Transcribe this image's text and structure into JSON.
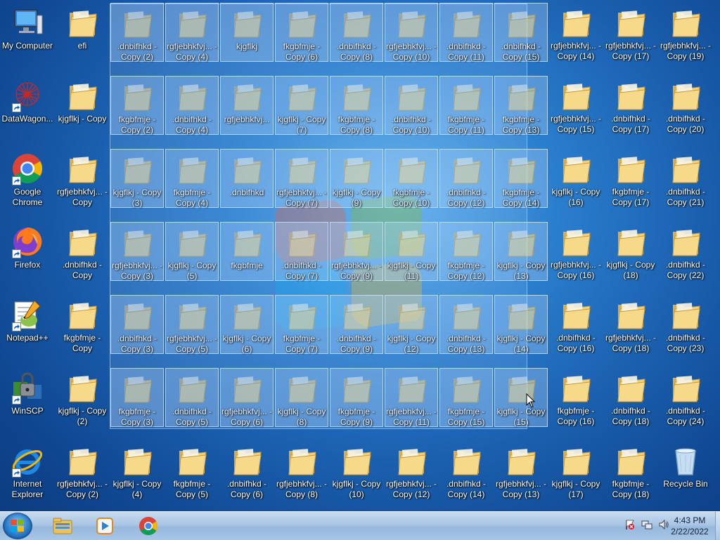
{
  "desktop": {
    "icons": [
      {
        "label": "My Computer",
        "type": "computer",
        "shortcut": false,
        "selected": false
      },
      {
        "label": "efi",
        "type": "folder",
        "shortcut": false,
        "selected": false
      },
      {
        "label": ".dnbifhkd - Copy (2)",
        "type": "folder",
        "shortcut": false,
        "selected": true
      },
      {
        "label": "rgfjebhkfvj... - Copy (4)",
        "type": "folder",
        "shortcut": false,
        "selected": true
      },
      {
        "label": "kjgflkj",
        "type": "folder",
        "shortcut": false,
        "selected": true
      },
      {
        "label": "fkgbfmje - Copy (6)",
        "type": "folder",
        "shortcut": false,
        "selected": true
      },
      {
        "label": ".dnbifhkd - Copy (8)",
        "type": "folder",
        "shortcut": false,
        "selected": true
      },
      {
        "label": "rgfjebhkfvj... - Copy (10)",
        "type": "folder",
        "shortcut": false,
        "selected": true
      },
      {
        "label": ".dnbifhkd - Copy (11)",
        "type": "folder",
        "shortcut": false,
        "selected": true
      },
      {
        "label": ".dnbifhkd - Copy (15)",
        "type": "folder",
        "shortcut": false,
        "selected": true
      },
      {
        "label": "rgfjebhkfvj... - Copy (14)",
        "type": "folder",
        "shortcut": false,
        "selected": false
      },
      {
        "label": "rgfjebhkfvj... - Copy (17)",
        "type": "folder",
        "shortcut": false,
        "selected": false
      },
      {
        "label": "rgfjebhkfvj... - Copy (19)",
        "type": "folder",
        "shortcut": false,
        "selected": false
      },
      {
        "label": "DataWagon...",
        "type": "datawagon",
        "shortcut": true,
        "selected": false
      },
      {
        "label": "kjgflkj - Copy",
        "type": "folder",
        "shortcut": false,
        "selected": false
      },
      {
        "label": "fkgbfmje - Copy (2)",
        "type": "folder",
        "shortcut": false,
        "selected": true
      },
      {
        "label": ".dnbifhkd - Copy (4)",
        "type": "folder",
        "shortcut": false,
        "selected": true
      },
      {
        "label": "rgfjebhkfvj...",
        "type": "folder",
        "shortcut": false,
        "selected": true
      },
      {
        "label": "kjgflkj - Copy (7)",
        "type": "folder",
        "shortcut": false,
        "selected": true
      },
      {
        "label": "fkgbfmje - Copy (8)",
        "type": "folder",
        "shortcut": false,
        "selected": true
      },
      {
        "label": ".dnbifhkd - Copy (10)",
        "type": "folder",
        "shortcut": false,
        "selected": true
      },
      {
        "label": "fkgbfmje - Copy (11)",
        "type": "folder",
        "shortcut": false,
        "selected": true
      },
      {
        "label": "fkgbfmje - Copy (13)",
        "type": "folder",
        "shortcut": false,
        "selected": true
      },
      {
        "label": "rgfjebhkfvj... - Copy (15)",
        "type": "folder",
        "shortcut": false,
        "selected": false
      },
      {
        "label": ".dnbifhkd - Copy (17)",
        "type": "folder",
        "shortcut": false,
        "selected": false
      },
      {
        "label": ".dnbifhkd - Copy (20)",
        "type": "folder",
        "shortcut": false,
        "selected": false
      },
      {
        "label": "Google Chrome",
        "type": "chrome",
        "shortcut": true,
        "selected": false
      },
      {
        "label": "rgfjebhkfvj... - Copy",
        "type": "folder",
        "shortcut": false,
        "selected": false
      },
      {
        "label": "kjgflkj - Copy (3)",
        "type": "folder",
        "shortcut": false,
        "selected": true
      },
      {
        "label": "fkgbfmje - Copy (4)",
        "type": "folder",
        "shortcut": false,
        "selected": true
      },
      {
        "label": ".dnbifhkd",
        "type": "folder",
        "shortcut": false,
        "selected": true
      },
      {
        "label": "rgfjebhkfvj... - Copy (7)",
        "type": "folder",
        "shortcut": false,
        "selected": true
      },
      {
        "label": "kjgflkj - Copy (9)",
        "type": "folder",
        "shortcut": false,
        "selected": true
      },
      {
        "label": "fkgbfmje - Copy (10)",
        "type": "folder",
        "shortcut": false,
        "selected": true
      },
      {
        "label": ".dnbifhkd - Copy (12)",
        "type": "folder",
        "shortcut": false,
        "selected": true
      },
      {
        "label": "fkgbfmje - Copy (14)",
        "type": "folder",
        "shortcut": false,
        "selected": true
      },
      {
        "label": "kjgflkj - Copy (16)",
        "type": "folder",
        "shortcut": false,
        "selected": false
      },
      {
        "label": "fkgbfmje - Copy (17)",
        "type": "folder",
        "shortcut": false,
        "selected": false
      },
      {
        "label": ".dnbifhkd - Copy (21)",
        "type": "folder",
        "shortcut": false,
        "selected": false
      },
      {
        "label": "Firefox",
        "type": "firefox",
        "shortcut": true,
        "selected": false
      },
      {
        "label": ".dnbifhkd - Copy",
        "type": "folder",
        "shortcut": false,
        "selected": false
      },
      {
        "label": "rgfjebhkfvj... - Copy (3)",
        "type": "folder",
        "shortcut": false,
        "selected": true
      },
      {
        "label": "kjgflkj - Copy (5)",
        "type": "folder",
        "shortcut": false,
        "selected": true
      },
      {
        "label": "fkgbfmje",
        "type": "folder",
        "shortcut": false,
        "selected": true
      },
      {
        "label": ".dnbifhkd - Copy (7)",
        "type": "folder",
        "shortcut": false,
        "selected": true
      },
      {
        "label": "rgfjebhkfvj... - Copy (9)",
        "type": "folder",
        "shortcut": false,
        "selected": true
      },
      {
        "label": "kjgflkj - Copy (11)",
        "type": "folder",
        "shortcut": false,
        "selected": true
      },
      {
        "label": "fkgbfmje - Copy (12)",
        "type": "folder",
        "shortcut": false,
        "selected": true
      },
      {
        "label": "kjgflkj - Copy (13)",
        "type": "folder",
        "shortcut": false,
        "selected": true
      },
      {
        "label": "rgfjebhkfvj... - Copy (16)",
        "type": "folder",
        "shortcut": false,
        "selected": false
      },
      {
        "label": "kjgflkj - Copy (18)",
        "type": "folder",
        "shortcut": false,
        "selected": false
      },
      {
        "label": ".dnbifhkd - Copy (22)",
        "type": "folder",
        "shortcut": false,
        "selected": false
      },
      {
        "label": "Notepad++",
        "type": "notepad",
        "shortcut": true,
        "selected": false
      },
      {
        "label": "fkgbfmje - Copy",
        "type": "folder",
        "shortcut": false,
        "selected": false
      },
      {
        "label": ".dnbifhkd - Copy (3)",
        "type": "folder",
        "shortcut": false,
        "selected": true
      },
      {
        "label": "rgfjebhkfvj... - Copy (5)",
        "type": "folder",
        "shortcut": false,
        "selected": true
      },
      {
        "label": "kjgflkj - Copy (6)",
        "type": "folder",
        "shortcut": false,
        "selected": true
      },
      {
        "label": "fkgbfmje - Copy (7)",
        "type": "folder",
        "shortcut": false,
        "selected": true
      },
      {
        "label": ".dnbifhkd - Copy (9)",
        "type": "folder",
        "shortcut": false,
        "selected": true
      },
      {
        "label": "kjgflkj - Copy (12)",
        "type": "folder",
        "shortcut": false,
        "selected": true
      },
      {
        "label": ".dnbifhkd - Copy (13)",
        "type": "folder",
        "shortcut": false,
        "selected": true
      },
      {
        "label": "kjgflkj - Copy (14)",
        "type": "folder",
        "shortcut": false,
        "selected": true
      },
      {
        "label": ".dnbifhkd - Copy (16)",
        "type": "folder",
        "shortcut": false,
        "selected": false
      },
      {
        "label": "rgfjebhkfvj... - Copy (18)",
        "type": "folder",
        "shortcut": false,
        "selected": false
      },
      {
        "label": ".dnbifhkd - Copy (23)",
        "type": "folder",
        "shortcut": false,
        "selected": false
      },
      {
        "label": "WinSCP",
        "type": "winscp",
        "shortcut": true,
        "selected": false
      },
      {
        "label": "kjgflkj - Copy (2)",
        "type": "folder",
        "shortcut": false,
        "selected": false
      },
      {
        "label": "fkgbfmje - Copy (3)",
        "type": "folder",
        "shortcut": false,
        "selected": true
      },
      {
        "label": ".dnbifhkd - Copy (5)",
        "type": "folder",
        "shortcut": false,
        "selected": true
      },
      {
        "label": "rgfjebhkfvj... - Copy (6)",
        "type": "folder",
        "shortcut": false,
        "selected": true
      },
      {
        "label": "kjgflkj - Copy (8)",
        "type": "folder",
        "shortcut": false,
        "selected": true
      },
      {
        "label": "fkgbfmje - Copy (9)",
        "type": "folder",
        "shortcut": false,
        "selected": true
      },
      {
        "label": "rgfjebhkfvj... - Copy (11)",
        "type": "folder",
        "shortcut": false,
        "selected": true
      },
      {
        "label": "fkgbfmje - Copy (15)",
        "type": "folder",
        "shortcut": false,
        "selected": true
      },
      {
        "label": "kjgflkj - Copy (15)",
        "type": "folder",
        "shortcut": false,
        "selected": true
      },
      {
        "label": "fkgbfmje - Copy (16)",
        "type": "folder",
        "shortcut": false,
        "selected": false
      },
      {
        "label": ".dnbifhkd - Copy (18)",
        "type": "folder",
        "shortcut": false,
        "selected": false
      },
      {
        "label": ".dnbifhkd - Copy (24)",
        "type": "folder",
        "shortcut": false,
        "selected": false
      },
      {
        "label": "Internet Explorer",
        "type": "ie",
        "shortcut": true,
        "selected": false
      },
      {
        "label": "rgfjebhkfvj... - Copy (2)",
        "type": "folder",
        "shortcut": false,
        "selected": false
      },
      {
        "label": "kjgflkj - Copy (4)",
        "type": "folder",
        "shortcut": false,
        "selected": false
      },
      {
        "label": "fkgbfmje - Copy (5)",
        "type": "folder",
        "shortcut": false,
        "selected": false
      },
      {
        "label": ".dnbifhkd - Copy (6)",
        "type": "folder",
        "shortcut": false,
        "selected": false
      },
      {
        "label": "rgfjebhkfvj... - Copy (8)",
        "type": "folder",
        "shortcut": false,
        "selected": false
      },
      {
        "label": "kjgflkj - Copy (10)",
        "type": "folder",
        "shortcut": false,
        "selected": false
      },
      {
        "label": "rgfjebhkfvj... - Copy (12)",
        "type": "folder",
        "shortcut": false,
        "selected": false
      },
      {
        "label": ".dnbifhkd - Copy (14)",
        "type": "folder",
        "shortcut": false,
        "selected": false
      },
      {
        "label": "rgfjebhkfvj... - Copy (13)",
        "type": "folder",
        "shortcut": false,
        "selected": false
      },
      {
        "label": "kjgflkj - Copy (17)",
        "type": "folder",
        "shortcut": false,
        "selected": false
      },
      {
        "label": "fkgbfmje - Copy (18)",
        "type": "folder",
        "shortcut": false,
        "selected": false
      },
      {
        "label": "Recycle Bin",
        "type": "recycle",
        "shortcut": false,
        "selected": false
      }
    ]
  },
  "taskbar": {
    "start_icon": "windows-start-orb",
    "pinned": [
      {
        "name": "explorer",
        "icon": "folder-explorer-icon"
      },
      {
        "name": "media-player",
        "icon": "media-player-icon"
      },
      {
        "name": "chrome",
        "icon": "chrome-icon"
      }
    ],
    "tray_icons": [
      "action-center-flag-icon",
      "network-icon",
      "volume-icon"
    ],
    "time": "4:43 PM",
    "date": "2/22/2022"
  },
  "colors": {
    "folder": "#f3d27a",
    "selection_fill": "#aad2ff",
    "taskbar": "#a9c5e4"
  }
}
